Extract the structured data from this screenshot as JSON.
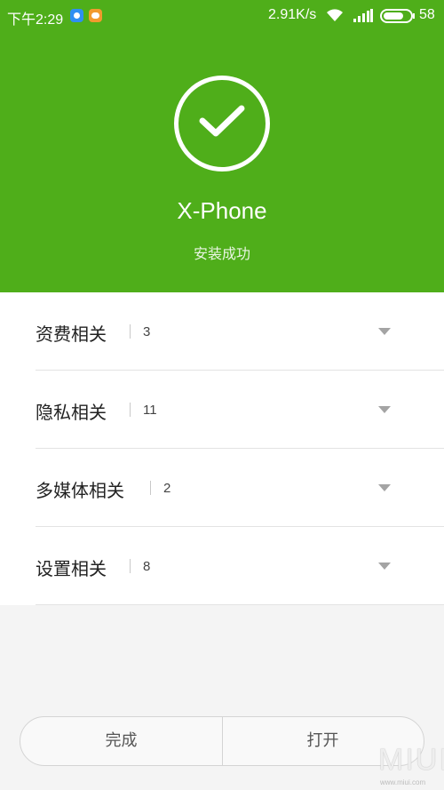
{
  "status_bar": {
    "time": "下午2:29",
    "speed": "2.91K/s",
    "battery": "58",
    "notification_icons": [
      "chat-app-icon",
      "message-app-icon"
    ]
  },
  "header": {
    "app_name": "X-Phone",
    "status": "安装成功",
    "accent_color": "#4fae1a"
  },
  "permissions": [
    {
      "label": "资费相关",
      "count": "3"
    },
    {
      "label": "隐私相关",
      "count": "11"
    },
    {
      "label": "多媒体相关",
      "count": "2"
    },
    {
      "label": "设置相关",
      "count": "8"
    }
  ],
  "buttons": {
    "done": "完成",
    "open": "打开"
  },
  "watermark": {
    "logo": "MIUI",
    "url": "www.miui.com"
  }
}
